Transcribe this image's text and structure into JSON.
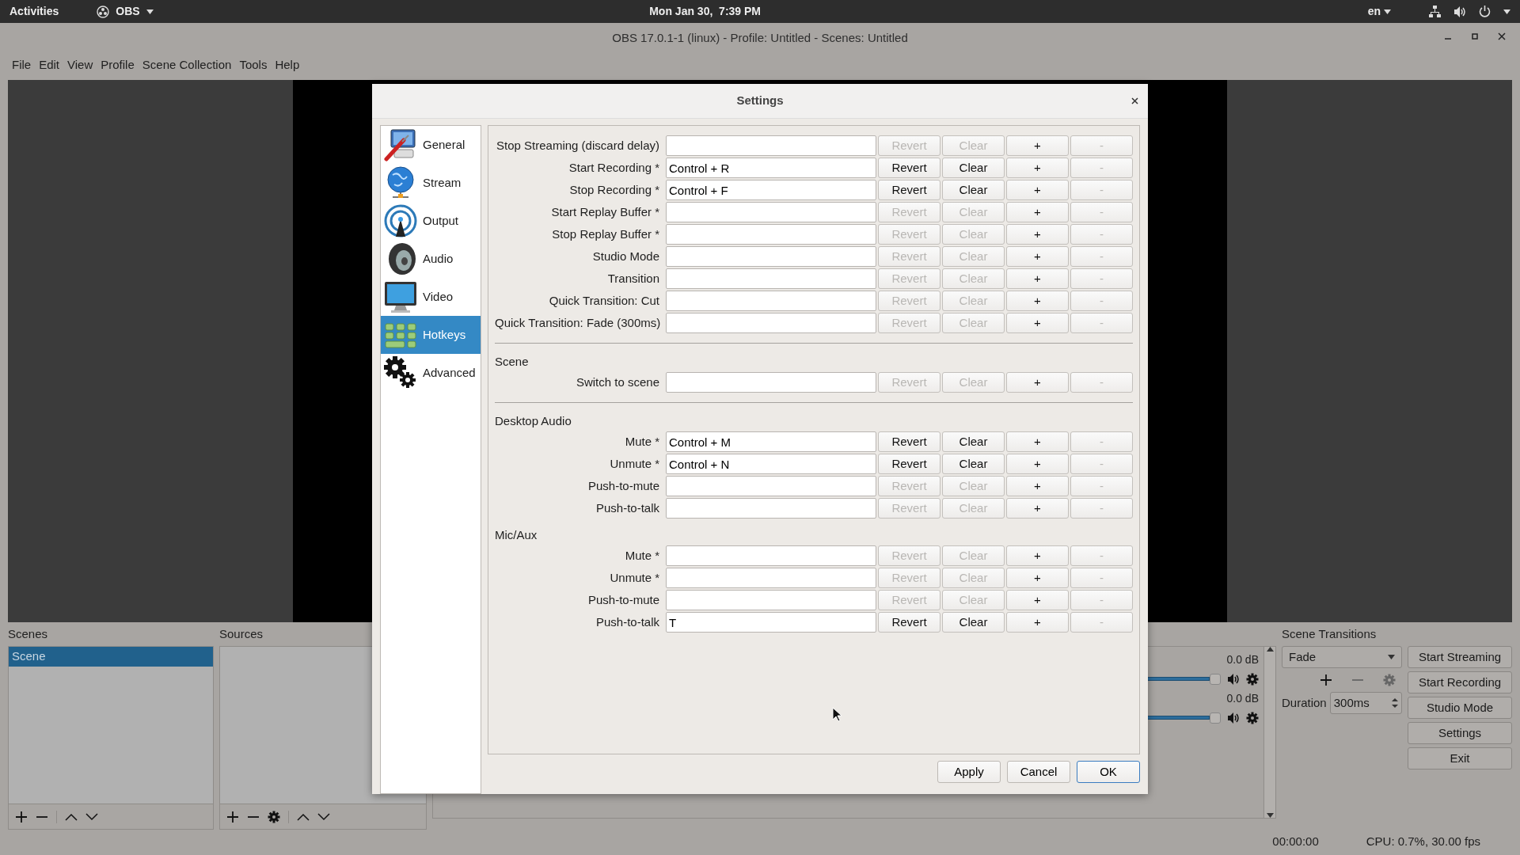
{
  "topbar": {
    "activities": "Activities",
    "app": "OBS",
    "clock": "Mon Jan 30,  7:39 PM",
    "language": "en"
  },
  "window": {
    "title": "OBS 17.0.1-1 (linux) - Profile: Untitled - Scenes: Untitled"
  },
  "menu": [
    "File",
    "Edit",
    "View",
    "Profile",
    "Scene Collection",
    "Tools",
    "Help"
  ],
  "scenes": {
    "title": "Scenes",
    "items": [
      {
        "label": "Scene",
        "selected": true
      }
    ]
  },
  "sources": {
    "title": "Sources"
  },
  "mixer": {
    "channels": [
      {
        "reading": "0.0 dB",
        "level": 1
      },
      {
        "reading": "0.0 dB",
        "level": 1
      }
    ]
  },
  "transitions": {
    "title": "Scene Transitions",
    "transition": "Fade",
    "duration_label": "Duration",
    "duration": "300ms"
  },
  "controls": [
    "Start Streaming",
    "Start Recording",
    "Studio Mode",
    "Settings",
    "Exit"
  ],
  "status_bar": {
    "time": "00:00:00",
    "cpu": "CPU: 0.7%, 30.00 fps"
  },
  "dialog": {
    "title": "Settings",
    "sidebar": [
      {
        "label": "General",
        "selected": false
      },
      {
        "label": "Stream",
        "selected": false
      },
      {
        "label": "Output",
        "selected": false
      },
      {
        "label": "Audio",
        "selected": false
      },
      {
        "label": "Video",
        "selected": false
      },
      {
        "label": "Hotkeys",
        "selected": true
      },
      {
        "label": "Advanced",
        "selected": false
      }
    ],
    "sections": [
      {
        "separator": false,
        "rows": [
          {
            "label": "Stop Streaming (discard delay)",
            "buttons": [
              {
                "label": "Revert",
                "disabled": true
              },
              {
                "label": "Clear",
                "disabled": true
              },
              {
                "label": "+",
                "disabled": false
              },
              {
                "label": "-",
                "disabled": true
              }
            ]
          },
          {
            "label": "Start Recording *",
            "value": "Control + R",
            "buttons": [
              {
                "label": "Revert",
                "disabled": false
              },
              {
                "label": "Clear",
                "disabled": false
              },
              {
                "label": "+",
                "disabled": false
              },
              {
                "label": "-",
                "disabled": true
              }
            ]
          },
          {
            "label": "Stop Recording *",
            "value": "Control + F",
            "buttons": [
              {
                "label": "Revert",
                "disabled": false
              },
              {
                "label": "Clear",
                "disabled": false
              },
              {
                "label": "+",
                "disabled": false
              },
              {
                "label": "-",
                "disabled": true
              }
            ]
          },
          {
            "label": "Start Replay Buffer *",
            "buttons": [
              {
                "label": "Revert",
                "disabled": true
              },
              {
                "label": "Clear",
                "disabled": true
              },
              {
                "label": "+",
                "disabled": false
              },
              {
                "label": "-",
                "disabled": true
              }
            ]
          },
          {
            "label": "Stop Replay Buffer *",
            "buttons": [
              {
                "label": "Revert",
                "disabled": true
              },
              {
                "label": "Clear",
                "disabled": true
              },
              {
                "label": "+",
                "disabled": false
              },
              {
                "label": "-",
                "disabled": true
              }
            ]
          },
          {
            "label": "Studio Mode",
            "buttons": [
              {
                "label": "Revert",
                "disabled": true
              },
              {
                "label": "Clear",
                "disabled": true
              },
              {
                "label": "+",
                "disabled": false
              },
              {
                "label": "-",
                "disabled": true
              }
            ]
          },
          {
            "label": "Transition",
            "buttons": [
              {
                "label": "Revert",
                "disabled": true
              },
              {
                "label": "Clear",
                "disabled": true
              },
              {
                "label": "+",
                "disabled": false
              },
              {
                "label": "-",
                "disabled": true
              }
            ]
          },
          {
            "label": "Quick Transition: Cut",
            "buttons": [
              {
                "label": "Revert",
                "disabled": true
              },
              {
                "label": "Clear",
                "disabled": true
              },
              {
                "label": "+",
                "disabled": false
              },
              {
                "label": "-",
                "disabled": true
              }
            ]
          },
          {
            "label": "Quick Transition: Fade (300ms)",
            "buttons": [
              {
                "label": "Revert",
                "disabled": true
              },
              {
                "label": "Clear",
                "disabled": true
              },
              {
                "label": "+",
                "disabled": false
              },
              {
                "label": "-",
                "disabled": true
              }
            ]
          }
        ]
      },
      {
        "separator": true,
        "heading": "Scene",
        "rows": [
          {
            "label": "Switch to scene",
            "buttons": [
              {
                "label": "Revert",
                "disabled": true
              },
              {
                "label": "Clear",
                "disabled": true
              },
              {
                "label": "+",
                "disabled": false
              },
              {
                "label": "-",
                "disabled": true
              }
            ]
          }
        ]
      },
      {
        "separator": true,
        "heading": "Desktop Audio",
        "rows": [
          {
            "label": "Mute *",
            "value": "Control + M",
            "buttons": [
              {
                "label": "Revert",
                "disabled": false
              },
              {
                "label": "Clear",
                "disabled": false
              },
              {
                "label": "+",
                "disabled": false
              },
              {
                "label": "-",
                "disabled": true
              }
            ]
          },
          {
            "label": "Unmute *",
            "value": "Control + N",
            "buttons": [
              {
                "label": "Revert",
                "disabled": false
              },
              {
                "label": "Clear",
                "disabled": false
              },
              {
                "label": "+",
                "disabled": false
              },
              {
                "label": "-",
                "disabled": true
              }
            ]
          },
          {
            "label": "Push-to-mute",
            "buttons": [
              {
                "label": "Revert",
                "disabled": true
              },
              {
                "label": "Clear",
                "disabled": true
              },
              {
                "label": "+",
                "disabled": false
              },
              {
                "label": "-",
                "disabled": true
              }
            ]
          },
          {
            "label": "Push-to-talk",
            "buttons": [
              {
                "label": "Revert",
                "disabled": true
              },
              {
                "label": "Clear",
                "disabled": true
              },
              {
                "label": "+",
                "disabled": false
              },
              {
                "label": "-",
                "disabled": true
              }
            ]
          }
        ]
      },
      {
        "separator": false,
        "heading": "Mic/Aux",
        "rows": [
          {
            "label": "Mute *",
            "buttons": [
              {
                "label": "Revert",
                "disabled": true
              },
              {
                "label": "Clear",
                "disabled": true
              },
              {
                "label": "+",
                "disabled": false
              },
              {
                "label": "-",
                "disabled": true
              }
            ]
          },
          {
            "label": "Unmute *",
            "buttons": [
              {
                "label": "Revert",
                "disabled": true
              },
              {
                "label": "Clear",
                "disabled": true
              },
              {
                "label": "+",
                "disabled": false
              },
              {
                "label": "-",
                "disabled": true
              }
            ]
          },
          {
            "label": "Push-to-mute",
            "buttons": [
              {
                "label": "Revert",
                "disabled": true
              },
              {
                "label": "Clear",
                "disabled": true
              },
              {
                "label": "+",
                "disabled": false
              },
              {
                "label": "-",
                "disabled": true
              }
            ]
          },
          {
            "label": "Push-to-talk",
            "value": "T",
            "buttons": [
              {
                "label": "Revert",
                "disabled": false
              },
              {
                "label": "Clear",
                "disabled": false
              },
              {
                "label": "+",
                "disabled": false
              },
              {
                "label": "-",
                "disabled": true
              }
            ]
          }
        ]
      }
    ],
    "footer": [
      {
        "label": "Apply",
        "focused": false
      },
      {
        "label": "Cancel",
        "focused": false
      },
      {
        "label": "OK",
        "focused": true
      }
    ]
  }
}
